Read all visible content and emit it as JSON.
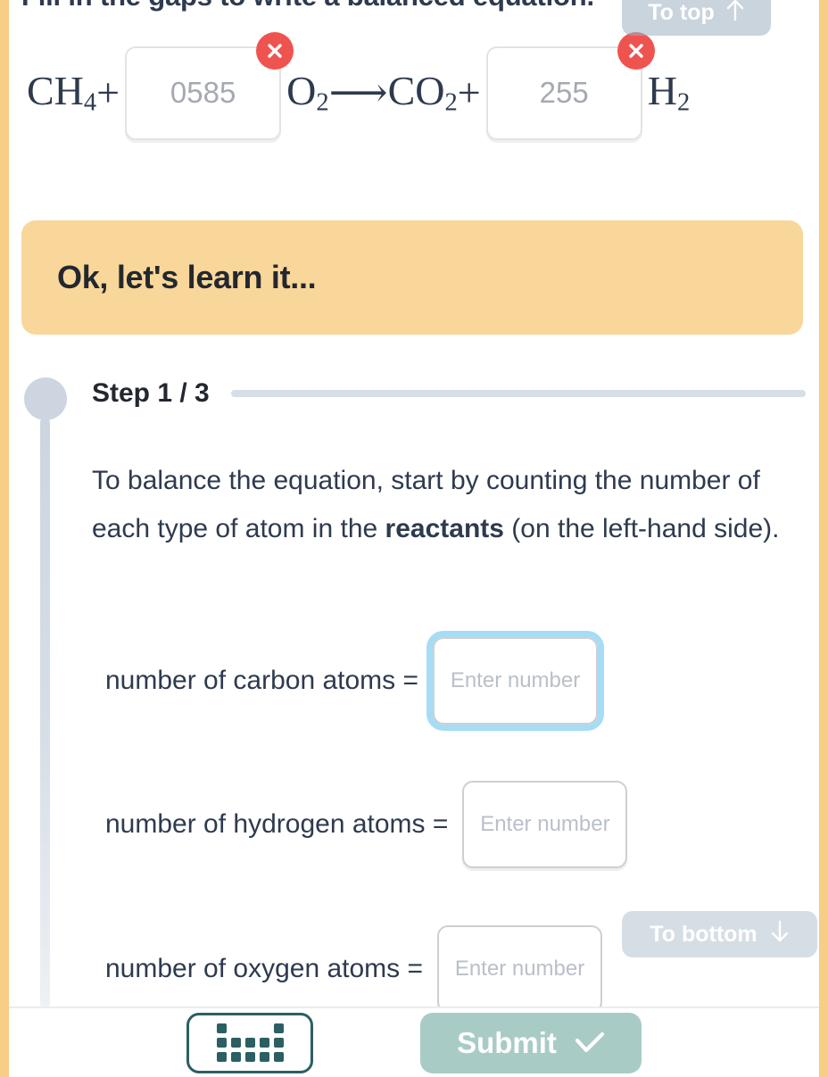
{
  "frame": {
    "border_color": "#f8cd86"
  },
  "prompt": {
    "title": "Fill in the gaps to write a balanced equation."
  },
  "equation": {
    "reactant_1": "CH",
    "reactant_1_sub": "4",
    "plus_1": "+",
    "blank_1_value": "0585",
    "blank_1_status": "incorrect",
    "reactant_2": "O",
    "reactant_2_sub": "2",
    "arrow": "⟶",
    "product_1": "CO",
    "product_1_sub": "2",
    "plus_2": "+",
    "blank_2_value": "255",
    "blank_2_status": "incorrect",
    "product_2": "H",
    "product_2_sub": "2"
  },
  "scroll_buttons": {
    "to_top_label": "To top",
    "to_top_icon": "arrow-up-icon",
    "to_bottom_label": "To bottom",
    "to_bottom_icon": "arrow-down-icon"
  },
  "learn_banner": {
    "text": "Ok, let's learn it...",
    "background": "#f9d79a"
  },
  "step": {
    "label": "Step 1 / 3",
    "body_part_1": "To balance the equation, start by counting the number of each type of atom in the ",
    "body_bold": "reactants",
    "body_part_2": " (on the left-hand side)."
  },
  "atom_rows": [
    {
      "label": "number of carbon atoms =",
      "placeholder": "Enter number",
      "value": "",
      "focused": true
    },
    {
      "label": "number of hydrogen atoms =",
      "placeholder": "Enter number",
      "value": "",
      "focused": false
    },
    {
      "label": "number of oxygen atoms =",
      "placeholder": "Enter number",
      "value": "",
      "focused": false
    }
  ],
  "bottom_bar": {
    "keyboard_icon": "keyboard-icon",
    "submit_label": "Submit",
    "submit_icon": "check-icon",
    "submit_color": "#a9cbc6"
  }
}
